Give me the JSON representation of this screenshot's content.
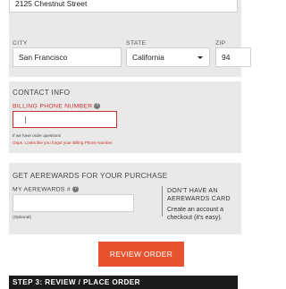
{
  "address": {
    "street_value": "2125 Chestnut Street",
    "city_label": "CITY",
    "city_value": "San Francisco",
    "state_label": "STATE",
    "state_value": "California",
    "zip_label": "ZIP",
    "zip_value": "94"
  },
  "contact": {
    "title": "CONTACT INFO",
    "phone_label": "BILLING PHONE NUMBER",
    "phone_value": "",
    "note": "If we have order questions",
    "error": "Oops. Looks like you forgot your Billing Phone Number."
  },
  "rewards": {
    "title": "GET AEREWARDS FOR YOUR PURCHASE",
    "number_label": "MY AEREWARDS #",
    "optional": "(Optional)",
    "side_head_1": "DON'T HAVE AN",
    "side_head_2": "AEREWARDS CARD",
    "side_body_1": "Create an account a",
    "side_body_2": "checkout (it's easy)."
  },
  "actions": {
    "review_label": "REVIEW ORDER"
  },
  "step": {
    "label": "STEP 3: REVIEW / PLACE ORDER"
  },
  "colors": {
    "accent": "#e8532f",
    "error": "#cc2e2e",
    "panel": "#e9e9e9",
    "step_bar": "#1a1a1a"
  }
}
